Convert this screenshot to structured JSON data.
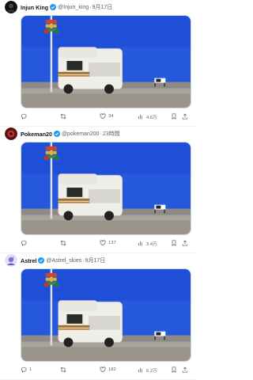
{
  "tweets": [
    {
      "name": "Injun King",
      "handle": "@Injun_king",
      "time": "9月17日",
      "replies": "",
      "retweets": "",
      "likes": "34",
      "views": "4.6万",
      "avatar_color": "#1a1a1a"
    },
    {
      "name": "Pokeman20",
      "handle": "@pokeman200",
      "time": "23時間",
      "replies": "",
      "retweets": "",
      "likes": "137",
      "views": "3.4万",
      "avatar_color": "#7a1f1f"
    },
    {
      "name": "Astrel",
      "handle": "@Astrel_skies",
      "time": "9月17日",
      "replies": "1",
      "retweets": "",
      "likes": "182",
      "views": "6.2万",
      "avatar_color": "#6a5acd"
    }
  ],
  "colors": {
    "verified": "#1d9bf0",
    "sky": "#1f4fd6",
    "ground": "#a9a49a"
  },
  "icons": [
    "verified-badge-icon",
    "reply-icon",
    "retweet-icon",
    "like-icon",
    "views-icon",
    "bookmark-icon",
    "share-icon"
  ]
}
